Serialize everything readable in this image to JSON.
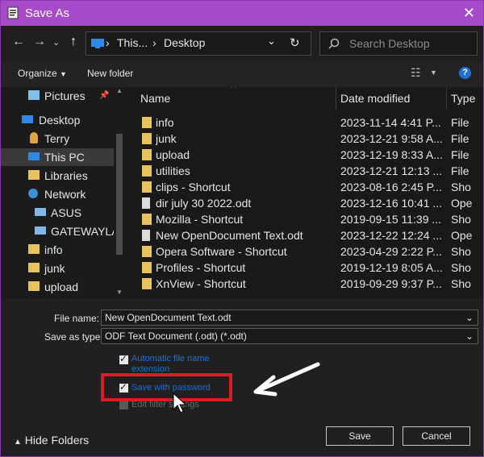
{
  "title": "Save As",
  "address": {
    "crumb1": "This...",
    "sep": "›",
    "crumb2": "Desktop"
  },
  "search": {
    "placeholder": "Search Desktop"
  },
  "toolbar": {
    "organize": "Organize",
    "new_folder": "New folder"
  },
  "nav": {
    "items": [
      {
        "label": "Pictures",
        "icon": "pictures-icon"
      },
      {
        "label": "Desktop",
        "icon": "desktop-icon"
      },
      {
        "label": "Terry",
        "icon": "user-icon"
      },
      {
        "label": "This PC",
        "icon": "pc-icon"
      },
      {
        "label": "Libraries",
        "icon": "libraries-icon"
      },
      {
        "label": "Network",
        "icon": "network-icon"
      },
      {
        "label": "ASUS",
        "icon": "computer-icon"
      },
      {
        "label": "GATEWAYLAPTOP",
        "icon": "computer-icon"
      },
      {
        "label": "info",
        "icon": "folder-icon"
      },
      {
        "label": "junk",
        "icon": "folder-icon"
      },
      {
        "label": "upload",
        "icon": "folder-icon"
      }
    ]
  },
  "columns": {
    "name": "Name",
    "date": "Date modified",
    "type": "Type"
  },
  "files": [
    {
      "name": "info",
      "date": "2023-11-14 4:41 P...",
      "type": "File",
      "icon": "folder-icon"
    },
    {
      "name": "junk",
      "date": "2023-12-21 9:58 A...",
      "type": "File",
      "icon": "folder-icon"
    },
    {
      "name": "upload",
      "date": "2023-12-19 8:33 A...",
      "type": "File",
      "icon": "folder-icon"
    },
    {
      "name": "utilities",
      "date": "2023-12-21 12:13 ...",
      "type": "File",
      "icon": "folder-icon"
    },
    {
      "name": "clips - Shortcut",
      "date": "2023-08-16 2:45 P...",
      "type": "Sho",
      "icon": "shortcut-folder-icon"
    },
    {
      "name": "dir july 30 2022.odt",
      "date": "2023-12-16 10:41 ...",
      "type": "Ope",
      "icon": "document-icon"
    },
    {
      "name": "Mozilla - Shortcut",
      "date": "2019-09-15 11:39 ...",
      "type": "Sho",
      "icon": "shortcut-folder-icon"
    },
    {
      "name": "New OpenDocument Text.odt",
      "date": "2023-12-22 12:24 ...",
      "type": "Ope",
      "icon": "document-icon"
    },
    {
      "name": "Opera Software - Shortcut",
      "date": "2023-04-29 2:22 P...",
      "type": "Sho",
      "icon": "shortcut-folder-icon"
    },
    {
      "name": "Profiles - Shortcut",
      "date": "2019-12-19 8:05 A...",
      "type": "Sho",
      "icon": "shortcut-folder-icon"
    },
    {
      "name": "XnView - Shortcut",
      "date": "2019-09-29 9:37 P...",
      "type": "Sho",
      "icon": "shortcut-folder-icon"
    }
  ],
  "form": {
    "filename_label": "File name:",
    "filename_value": "New OpenDocument Text.odt",
    "savetype_label": "Save as type:",
    "savetype_value": "ODF Text Document (.odt) (*.odt)",
    "auto_ext_line1": "Automatic file name",
    "auto_ext_line2": "extension",
    "save_password": "Save with password",
    "edit_filter": "Edit filter settings"
  },
  "footer": {
    "hide_folders": "Hide Folders",
    "save": "Save",
    "cancel": "Cancel"
  },
  "colors": {
    "titlebar": "#a64ac9",
    "highlight_box": "#e01b24",
    "link_blue": "#1e6fd9"
  }
}
